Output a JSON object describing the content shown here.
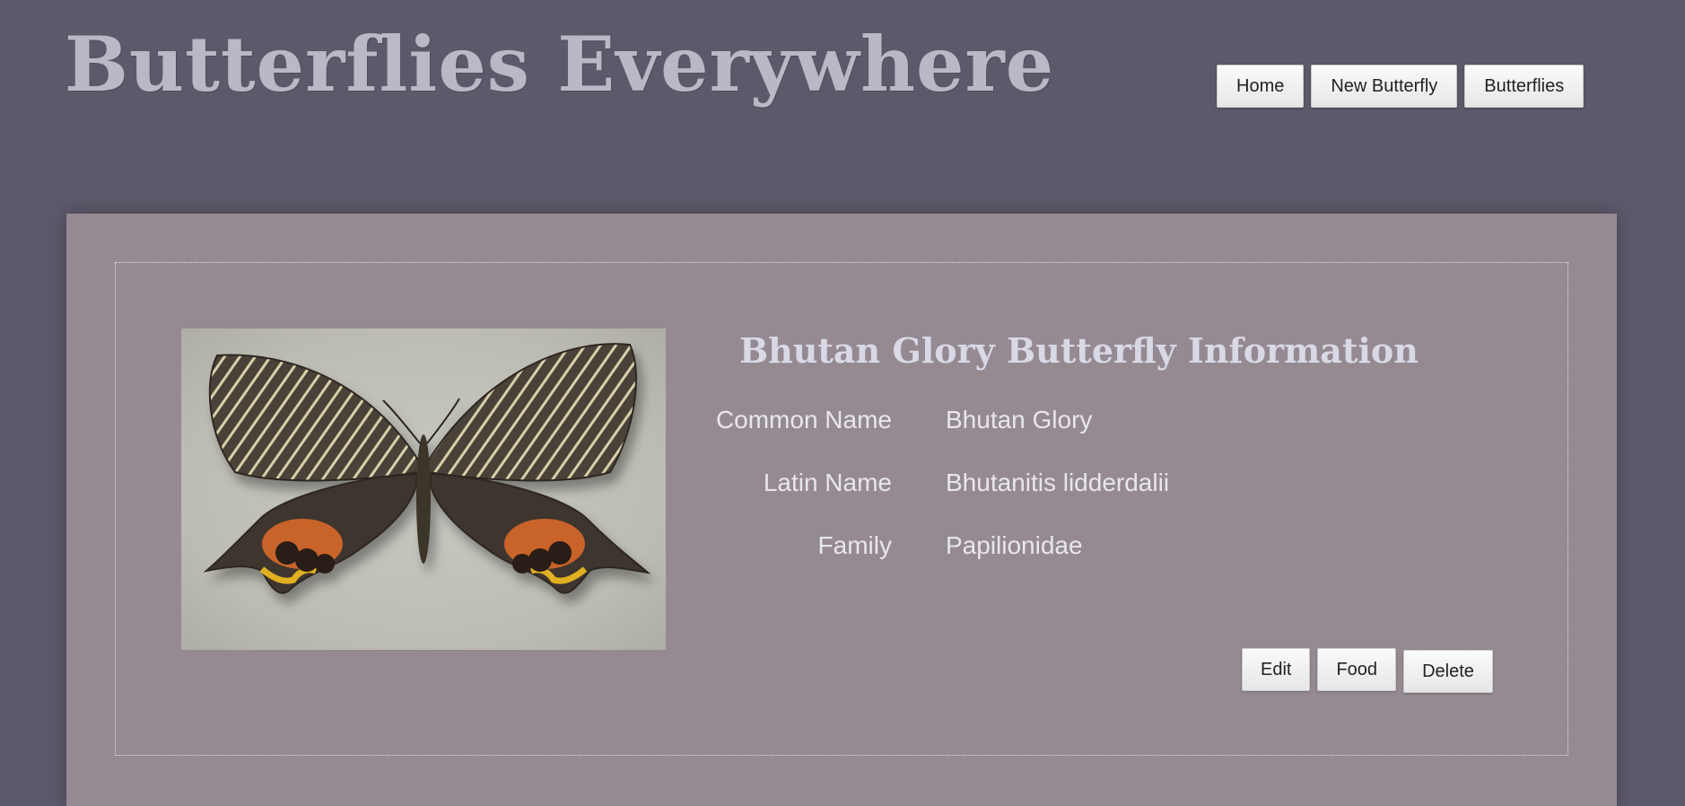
{
  "header": {
    "site_title": "Butterflies Everywhere",
    "nav": {
      "home_label": "Home",
      "new_butterfly_label": "New Butterfly",
      "butterflies_label": "Butterflies"
    }
  },
  "detail": {
    "title": "Bhutan Glory Butterfly Information",
    "image_subject": "butterfly-specimen-photo",
    "fields": [
      {
        "label": "Common Name",
        "value": "Bhutan Glory"
      },
      {
        "label": "Latin Name",
        "value": "Bhutanitis lidderdalii"
      },
      {
        "label": "Family",
        "value": "Papilionidae"
      }
    ],
    "actions": {
      "edit_label": "Edit",
      "food_label": "Food",
      "delete_label": "Delete"
    }
  },
  "colors": {
    "page_background": "#5d596b",
    "panel_background": "#958a92",
    "title_text": "#b8b8c6",
    "info_text": "#e8e6ee"
  }
}
